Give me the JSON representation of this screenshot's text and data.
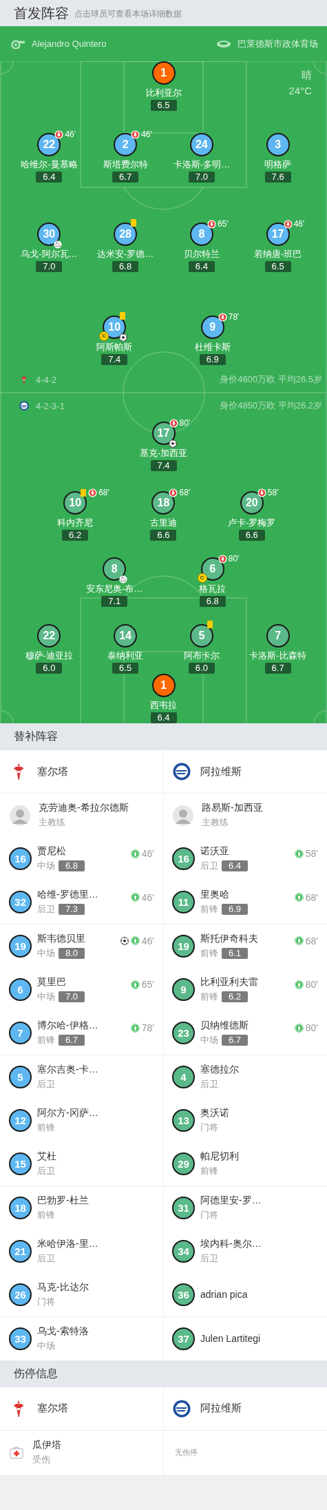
{
  "header": {
    "title": "首发阵容",
    "hint": "点击球员可查看本场详细数据"
  },
  "match": {
    "referee": "Alejandro Quintero",
    "venue": "巴莱德斯市政体育场",
    "weather": "晴",
    "temperature": "24°C"
  },
  "lineups": [
    {
      "color": "#5eb7f0",
      "formation": "4-4-2",
      "value_info": "身价4600万欧 平均26.5岁",
      "goalkeeper": {
        "number": "1",
        "name": "比利亚尔",
        "rating": "6.5"
      },
      "lines": [
        {
          "players": [
            {
              "number": "22",
              "name": "哈维尔-曼基略",
              "rating": "6.4",
              "events": [
                {
                  "kind": "sub_off",
                  "minute": "46'"
                }
              ]
            },
            {
              "number": "2",
              "name": "斯塔费尔特",
              "rating": "6.7",
              "events": [
                {
                  "kind": "sub_off",
                  "minute": "46'"
                }
              ]
            },
            {
              "number": "24",
              "name": "卡洛斯-多明…",
              "rating": "7.0"
            },
            {
              "number": "3",
              "name": "明格萨",
              "rating": "7.6"
            }
          ]
        },
        {
          "players": [
            {
              "number": "30",
              "name": "乌戈-阿尔瓦…",
              "rating": "7.0",
              "events": [
                {
                  "kind": "assist"
                }
              ]
            },
            {
              "number": "28",
              "name": "达米安-罗德…",
              "rating": "6.8",
              "events": [
                {
                  "kind": "yellow_card"
                }
              ]
            },
            {
              "number": "8",
              "name": "贝尔特兰",
              "rating": "6.4",
              "events": [
                {
                  "kind": "sub_off",
                  "minute": "65'"
                }
              ]
            },
            {
              "number": "17",
              "name": "若纳唐-班巴",
              "rating": "6.5",
              "events": [
                {
                  "kind": "sub_off",
                  "minute": "46'"
                }
              ]
            }
          ]
        },
        {
          "players": [
            {
              "number": "10",
              "name": "阿斯帕斯",
              "rating": "7.4",
              "events": [
                {
                  "kind": "yellow_card"
                },
                {
                  "kind": "captain",
                  "label": "C"
                },
                {
                  "kind": "goal"
                }
              ]
            },
            {
              "number": "9",
              "name": "杜维卡斯",
              "rating": "6.9",
              "events": [
                {
                  "kind": "sub_off",
                  "minute": "78'"
                }
              ]
            }
          ]
        }
      ]
    },
    {
      "color": "#5bb98a",
      "formation": "4-2-3-1",
      "value_info": "身价4850万欧 平均26.2岁",
      "goalkeeper": {
        "number": "1",
        "name": "西韦拉",
        "rating": "6.4"
      },
      "lines": [
        {
          "players": [
            {
              "number": "17",
              "name": "基克-加西亚",
              "rating": "7.4",
              "events": [
                {
                  "kind": "sub_off",
                  "minute": "80'"
                },
                {
                  "kind": "goal"
                }
              ]
            }
          ]
        },
        {
          "players": [
            {
              "number": "10",
              "name": "科内齐尼",
              "rating": "6.2",
              "events": [
                {
                  "kind": "yellow_card"
                },
                {
                  "kind": "sub_off",
                  "minute": "68'"
                }
              ]
            },
            {
              "number": "18",
              "name": "古里迪",
              "rating": "6.6",
              "events": [
                {
                  "kind": "sub_off",
                  "minute": "68'"
                }
              ]
            },
            {
              "number": "20",
              "name": "卢卡-罗梅罗",
              "rating": "6.6",
              "events": [
                {
                  "kind": "sub_off",
                  "minute": "58'"
                }
              ]
            }
          ]
        },
        {
          "players": [
            {
              "number": "8",
              "name": "安东尼奥-布…",
              "rating": "7.1",
              "events": [
                {
                  "kind": "assist"
                }
              ]
            },
            {
              "number": "6",
              "name": "格瓦拉",
              "rating": "6.8",
              "events": [
                {
                  "kind": "sub_off",
                  "minute": "80'"
                },
                {
                  "kind": "captain",
                  "label": "C"
                }
              ]
            }
          ]
        },
        {
          "players": [
            {
              "number": "22",
              "name": "穆萨-迪亚拉",
              "rating": "6.0"
            },
            {
              "number": "14",
              "name": "泰纳利亚",
              "rating": "6.5"
            },
            {
              "number": "5",
              "name": "阿布卡尔",
              "rating": "6.0",
              "events": [
                {
                  "kind": "yellow_card"
                }
              ]
            },
            {
              "number": "7",
              "name": "卡洛斯-比森特",
              "rating": "6.7"
            }
          ]
        }
      ]
    }
  ],
  "substitutes": {
    "title": "替补阵容",
    "teams": [
      {
        "name": "塞尔塔",
        "color": "#5eb7f0",
        "coach": {
          "name": "克劳迪奥-希拉尔德斯",
          "role": "主教练"
        },
        "players": [
          {
            "number": "16",
            "name": "贾尼松",
            "position": "中场",
            "rating": "6.8",
            "events": [
              {
                "kind": "sub_on",
                "minute": "46'"
              }
            ]
          },
          {
            "number": "32",
            "name": "哈维-罗德里…",
            "position": "后卫",
            "rating": "7.3",
            "events": [
              {
                "kind": "sub_on",
                "minute": "46'"
              }
            ]
          },
          {
            "number": "19",
            "name": "斯韦德贝里",
            "position": "中场",
            "rating": "8.0",
            "events": [
              {
                "kind": "goal"
              },
              {
                "kind": "sub_on",
                "minute": "46'"
              }
            ]
          },
          {
            "number": "6",
            "name": "莫里巴",
            "position": "中场",
            "rating": "7.0",
            "events": [
              {
                "kind": "sub_on",
                "minute": "65'"
              }
            ]
          },
          {
            "number": "7",
            "name": "博尔哈-伊格…",
            "position": "前锋",
            "rating": "6.7",
            "events": [
              {
                "kind": "sub_on",
                "minute": "78'"
              }
            ]
          },
          {
            "number": "5",
            "name": "塞尔吉奥-卡…",
            "position": "后卫"
          },
          {
            "number": "12",
            "name": "阿尔方-冈萨…",
            "position": "前锋"
          },
          {
            "number": "15",
            "name": "艾杜",
            "position": "后卫"
          },
          {
            "number": "18",
            "name": "巴勃罗-杜兰",
            "position": "前锋"
          },
          {
            "number": "21",
            "name": "米哈伊洛-里…",
            "position": "后卫"
          },
          {
            "number": "26",
            "name": "马克-比达尔",
            "position": "门将"
          },
          {
            "number": "33",
            "name": "乌戈-索特洛",
            "position": "中场"
          }
        ]
      },
      {
        "name": "阿拉维斯",
        "color": "#5bb98a",
        "coach": {
          "name": "路易斯-加西亚",
          "role": "主教练"
        },
        "players": [
          {
            "number": "16",
            "name": "诺沃亚",
            "position": "后卫",
            "rating": "6.4",
            "events": [
              {
                "kind": "sub_on",
                "minute": "58'"
              }
            ]
          },
          {
            "number": "11",
            "name": "里奥哈",
            "position": "前锋",
            "rating": "6.9",
            "events": [
              {
                "kind": "sub_on",
                "minute": "68'"
              }
            ]
          },
          {
            "number": "19",
            "name": "斯托伊奇科夫",
            "position": "前锋",
            "rating": "6.1",
            "events": [
              {
                "kind": "sub_on",
                "minute": "68'"
              }
            ]
          },
          {
            "number": "9",
            "name": "比利亚利夫雷",
            "position": "前锋",
            "rating": "6.2",
            "events": [
              {
                "kind": "sub_on",
                "minute": "80'"
              }
            ]
          },
          {
            "number": "23",
            "name": "贝纳维德斯",
            "position": "中场",
            "rating": "6.7",
            "events": [
              {
                "kind": "sub_on",
                "minute": "80'"
              }
            ]
          },
          {
            "number": "4",
            "name": "塞德拉尔",
            "position": "后卫"
          },
          {
            "number": "13",
            "name": "奥沃诺",
            "position": "门将"
          },
          {
            "number": "29",
            "name": "帕尼切利",
            "position": "前锋"
          },
          {
            "number": "31",
            "name": "阿德里安-罗…",
            "position": "门将"
          },
          {
            "number": "34",
            "name": "埃内科-奥尔…",
            "position": "后卫"
          },
          {
            "number": "36",
            "name": "adrian pica"
          },
          {
            "number": "37",
            "name": "Julen Lartitegi"
          }
        ]
      }
    ]
  },
  "injuries": {
    "title": "伤停信息",
    "teams": [
      {
        "name": "塞尔塔",
        "players": [
          {
            "name": "瓜伊塔",
            "status": "受伤"
          }
        ]
      },
      {
        "name": "阿拉维斯",
        "empty_note": "无伤停"
      }
    ]
  }
}
